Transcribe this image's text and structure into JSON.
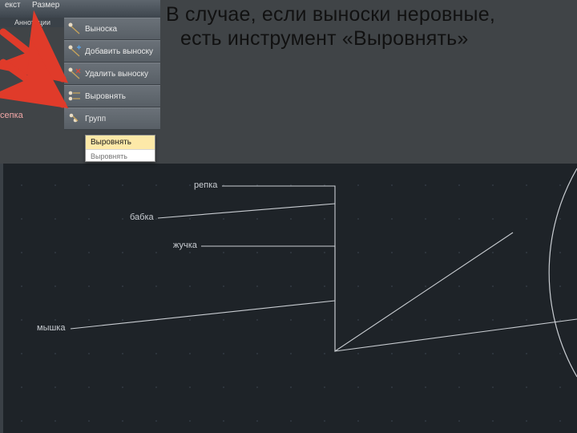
{
  "title_line1": "В случае, если выноски неровные,",
  "title_line2": "есть инструмент «Выровнять»",
  "ribbon": {
    "btn_text": "екст",
    "btn_size": "Размер",
    "section": "Аннотации"
  },
  "ghost_label": "сепка",
  "menu": {
    "items": [
      {
        "label": "Выноска"
      },
      {
        "label": "Добавить выноску"
      },
      {
        "label": "Удалить выноску"
      },
      {
        "label": "Выровнять"
      },
      {
        "label": "Групп"
      }
    ],
    "submenu": {
      "highlight": "Выровнять",
      "second": "Выровнять"
    }
  },
  "callouts": {
    "repka": "репка",
    "babka": "бабка",
    "zhuchka": "жучка",
    "myshka": "мышка"
  },
  "colors": {
    "arrow": "#e03b2a",
    "canvas_line": "#c9cdd2",
    "background": "#404447"
  }
}
